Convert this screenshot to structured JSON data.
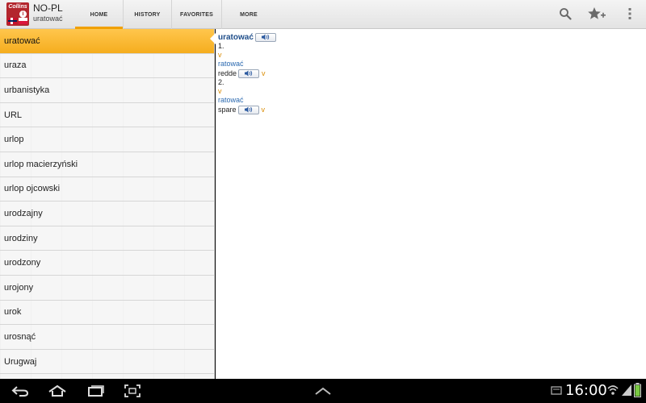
{
  "app": {
    "title": "NO-PL",
    "subtitle": "uratować",
    "icon_brand": "Collins",
    "icon_badge": "i"
  },
  "tabs": [
    {
      "label": "HOME",
      "selected": true
    },
    {
      "label": "HISTORY",
      "selected": false
    },
    {
      "label": "FAVORITES",
      "selected": false
    },
    {
      "label": "MORE",
      "selected": false
    }
  ],
  "actions": {
    "search_icon": "search-icon",
    "favorite_icon": "star-plus-icon",
    "overflow_icon": "overflow-menu-icon"
  },
  "list": {
    "items": [
      "uratować",
      "uraza",
      "urbanistyka",
      "URL",
      "urlop",
      "urlop macierzyński",
      "urlop ojcowski",
      "urodzajny",
      "urodziny",
      "urodzony",
      "urojony",
      "urok",
      "urosnąć",
      "Urugwaj"
    ],
    "selected_index": 0
  },
  "entry": {
    "headword": "uratować",
    "senses": [
      {
        "number": "1.",
        "pos": "v",
        "translation_head": "ratować",
        "translation": "redde",
        "translation_pos": "v"
      },
      {
        "number": "2.",
        "pos": "v",
        "translation_head": "ratować",
        "translation": "spare",
        "translation_pos": "v"
      }
    ]
  },
  "system": {
    "clock": "16:00"
  },
  "colors": {
    "accent": "#f0a000",
    "selected_item": "#f7b52b",
    "headword": "#1f4e8a",
    "pos": "#d98a00"
  }
}
